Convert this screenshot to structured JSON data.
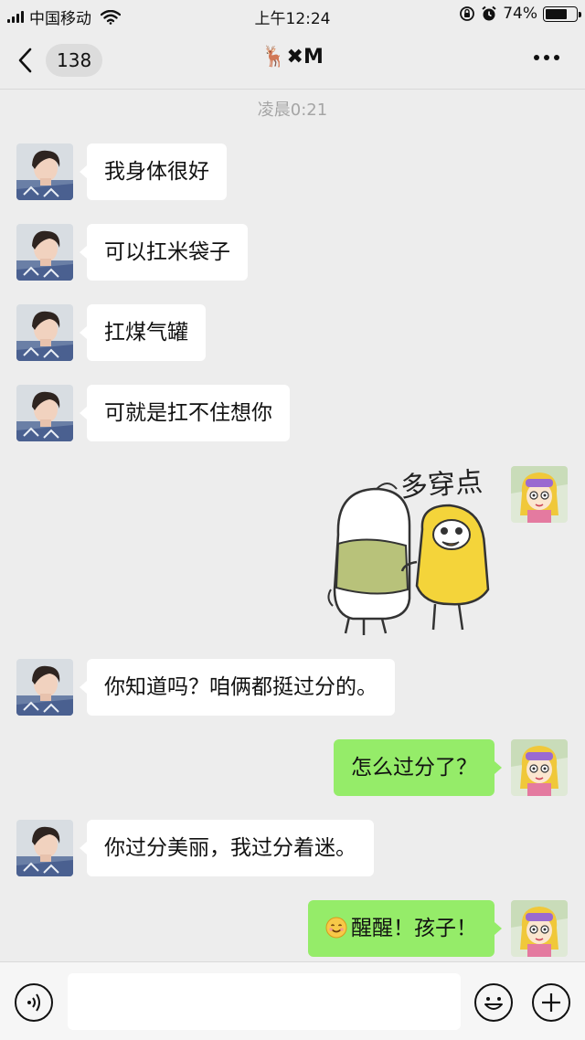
{
  "status_bar": {
    "carrier": "中国移动",
    "time": "上午12:24",
    "battery": "74%",
    "battery_level": 0.74
  },
  "header": {
    "back_count": "138",
    "title": "🦌✖M"
  },
  "timestamp": "凌晨0:21",
  "messages": [
    {
      "from": "other",
      "type": "text",
      "text": "我身体很好"
    },
    {
      "from": "other",
      "type": "text",
      "text": "可以扛米袋子"
    },
    {
      "from": "other",
      "type": "text",
      "text": "扛煤气罐"
    },
    {
      "from": "other",
      "type": "text",
      "text": "可就是扛不住想你"
    },
    {
      "from": "me",
      "type": "sticker",
      "text": "多穿点"
    },
    {
      "from": "other",
      "type": "text",
      "text": "你知道吗？咱俩都挺过分的。"
    },
    {
      "from": "me",
      "type": "text",
      "text": "怎么过分了？"
    },
    {
      "from": "other",
      "type": "text",
      "text": "你过分美丽，我过分着迷。"
    },
    {
      "from": "me",
      "type": "text",
      "emoji": "smile-emoji",
      "text": "醒醒！孩子！"
    }
  ],
  "input_bar": {
    "placeholder": "",
    "icons": [
      "voice-icon",
      "emoji-icon",
      "plus-icon"
    ]
  },
  "colors": {
    "background": "#ededed",
    "outgoing_bubble": "#95ec69",
    "incoming_bubble": "#ffffff"
  }
}
